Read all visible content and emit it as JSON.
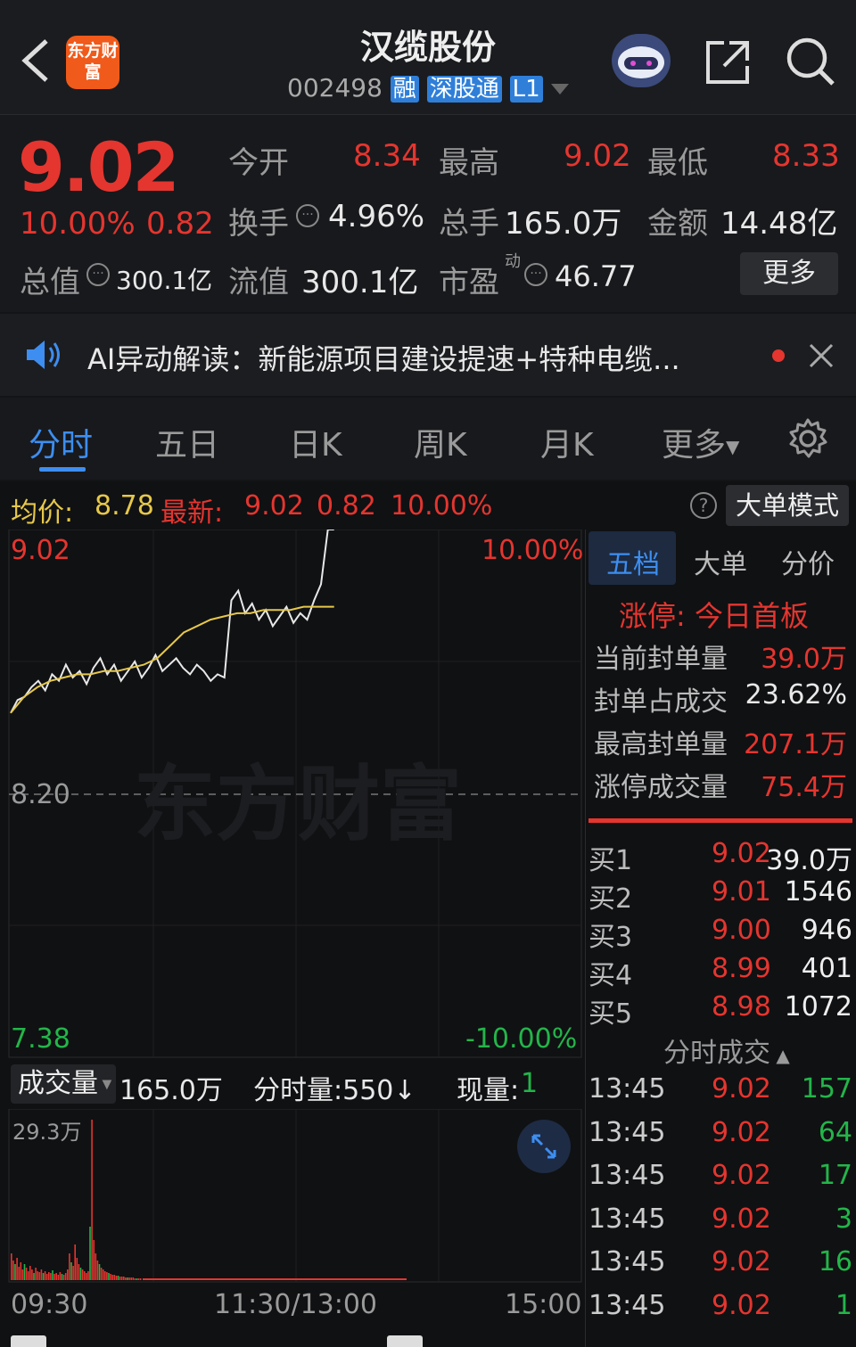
{
  "header": {
    "app_logo_text": "东方财富",
    "stock_name": "汉缆股份",
    "stock_code": "002498",
    "badges": [
      "融",
      "深股通",
      "L1"
    ]
  },
  "quote": {
    "price": "9.02",
    "change_pct": "10.00%",
    "change_abs": "0.82",
    "open_label": "今开",
    "open": "8.34",
    "high_label": "最高",
    "high": "9.02",
    "low_label": "最低",
    "low": "8.33",
    "turnover_label": "换手",
    "turnover": "4.96%",
    "volume_label": "总手",
    "volume": "165.0万",
    "amount_label": "金额",
    "amount": "14.48亿",
    "total_cap_label": "总值",
    "total_cap": "300.1亿",
    "float_cap_label": "流值",
    "float_cap": "300.1亿",
    "pe_label": "市盈",
    "pe_sup": "动",
    "pe": "46.77",
    "more_label": "更多"
  },
  "ai_bar": {
    "text": "AI异动解读：新能源项目建设提速+特种电缆..."
  },
  "tabs": [
    "分时",
    "五日",
    "日K",
    "周K",
    "月K",
    "更多"
  ],
  "info_bar": {
    "avg_label": "均价:",
    "avg": "8.78",
    "latest_label": "最新:",
    "latest": "9.02",
    "latest_change": "0.82",
    "latest_pct": "10.00%",
    "mode_button": "大单模式"
  },
  "price_axis": {
    "top": "9.02",
    "mid": "8.20",
    "bottom": "7.38",
    "top_pct": "10.00%",
    "bottom_pct": "-10.00%"
  },
  "watermark": "东方财富",
  "volume_bar": {
    "selector": "成交量",
    "total": "165.0万",
    "period_label": "分时量:550↓",
    "current_label": "现量:",
    "current": "1",
    "max_label": "29.3万"
  },
  "time_axis": [
    "09:30",
    "11:30/13:00",
    "15:00"
  ],
  "right_panel": {
    "tabs": [
      "五档",
      "大单",
      "分价"
    ],
    "limit_title": "涨停: 今日首板",
    "stats": [
      {
        "label": "当前封单量",
        "value": "39.0万",
        "color": "#e5352f"
      },
      {
        "label": "封单占成交",
        "value": "23.62%",
        "color": "#e8e8e8"
      },
      {
        "label": "最高封单量",
        "value": "207.1万",
        "color": "#e5352f"
      },
      {
        "label": "涨停成交量",
        "value": "75.4万",
        "color": "#e5352f"
      }
    ],
    "bids": [
      {
        "label": "买1",
        "price": "9.02",
        "vol": "39.0万"
      },
      {
        "label": "买2",
        "price": "9.01",
        "vol": "1546"
      },
      {
        "label": "买3",
        "price": "9.00",
        "vol": "946"
      },
      {
        "label": "买4",
        "price": "8.99",
        "vol": "401"
      },
      {
        "label": "买5",
        "price": "8.98",
        "vol": "1072"
      }
    ],
    "ticks_title": "分时成交",
    "ticks": [
      {
        "time": "13:45",
        "price": "9.02",
        "vol": "157"
      },
      {
        "time": "13:45",
        "price": "9.02",
        "vol": "64"
      },
      {
        "time": "13:45",
        "price": "9.02",
        "vol": "17"
      },
      {
        "time": "13:45",
        "price": "9.02",
        "vol": "3"
      },
      {
        "time": "13:45",
        "price": "9.02",
        "vol": "16"
      },
      {
        "time": "13:45",
        "price": "9.02",
        "vol": "1"
      }
    ]
  },
  "colors": {
    "up": "#e5352f",
    "down": "#23b54a",
    "accent": "#3d8ef0",
    "avg_line": "#e6c84a"
  }
}
